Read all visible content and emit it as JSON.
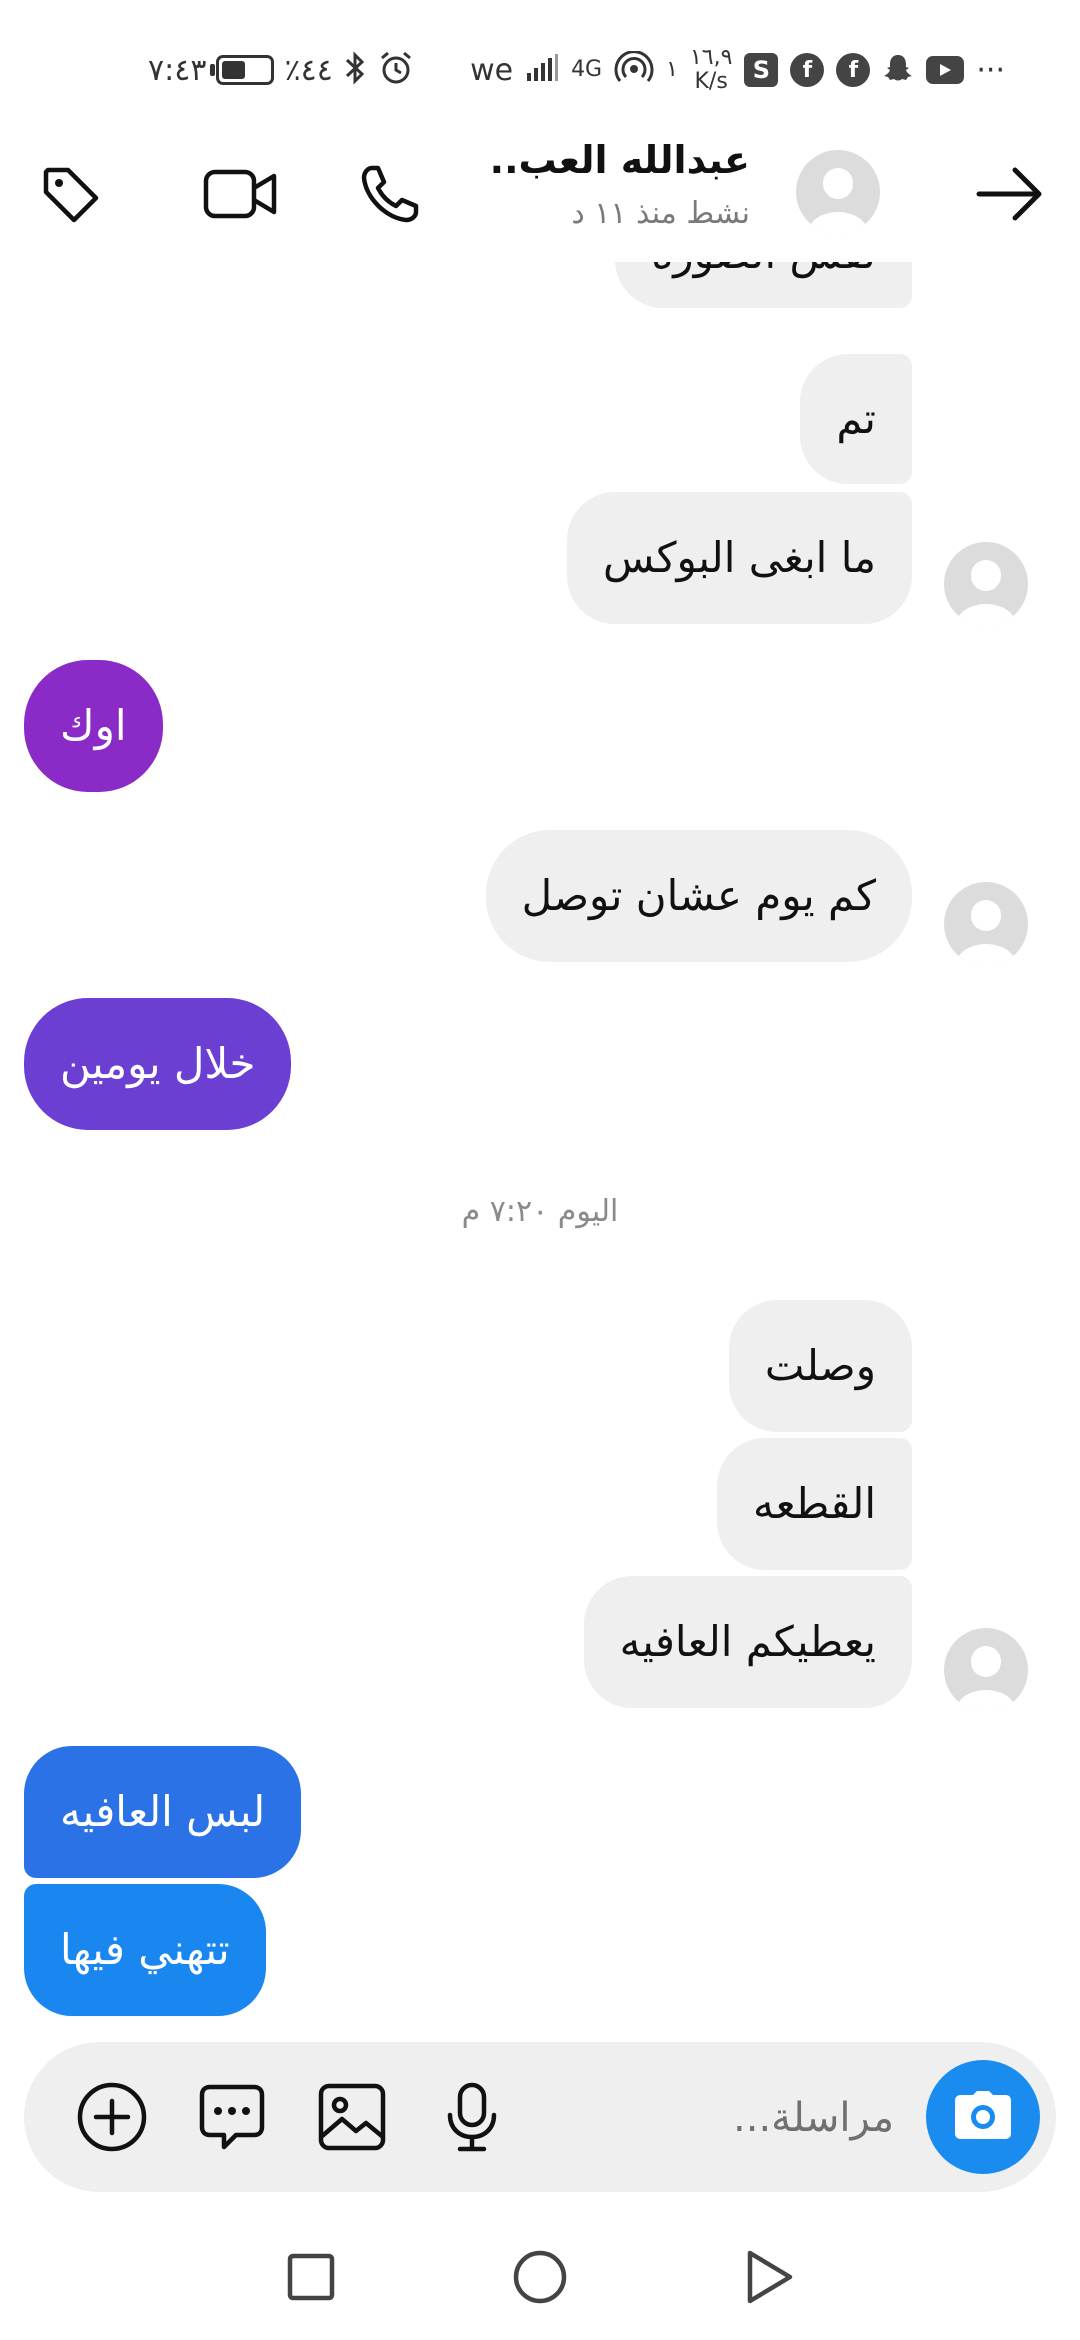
{
  "status_bar": {
    "time": "٧:٤٣",
    "battery": "٪٤٤",
    "battery_level": 0.44,
    "carrier": "we",
    "network": "4G",
    "speed_value": "١٦,٩",
    "speed_unit": "K/s",
    "more": "···",
    "sim_indicator": "١",
    "app_s_letter": "S"
  },
  "header": {
    "contact_name": "عبدالله العب..",
    "contact_status": "نشط منذ ١١ د"
  },
  "messages": [
    {
      "text": "نفس الصوره",
      "side": "in"
    },
    {
      "text": "تم",
      "side": "in"
    },
    {
      "text": "ما ابغى البوكس",
      "side": "in"
    },
    {
      "text": "اوك",
      "side": "out",
      "color": "#8a2bc8"
    },
    {
      "text": "كم يوم عشان توصل",
      "side": "in"
    },
    {
      "text": "خلال يومين",
      "side": "out",
      "color": "#6a3fd2"
    },
    {
      "text": "وصلت",
      "side": "in"
    },
    {
      "text": "القطعه",
      "side": "in"
    },
    {
      "text": "يعطيكم العافيه",
      "side": "in"
    },
    {
      "text": "لبس العافيه",
      "side": "out",
      "color": "#2b72e6"
    },
    {
      "text": "تتهني فيها",
      "side": "out",
      "color": "#1a87f0"
    }
  ],
  "date_separator": "اليوم ٧:٢٠ م",
  "composer": {
    "placeholder": "مراسلة..."
  },
  "colors": {
    "accent_blue": "#1a8cf0",
    "incoming_bubble": "#efefef",
    "gradient_top": "#8a2bc8",
    "gradient_bottom": "#1a87f0"
  },
  "icons": [
    "arrow-right-icon",
    "phone-icon",
    "video-icon",
    "tag-icon",
    "camera-icon",
    "microphone-icon",
    "image-icon",
    "sticker-icon",
    "plus-icon",
    "nav-back-icon",
    "nav-home-icon",
    "nav-recents-icon"
  ]
}
